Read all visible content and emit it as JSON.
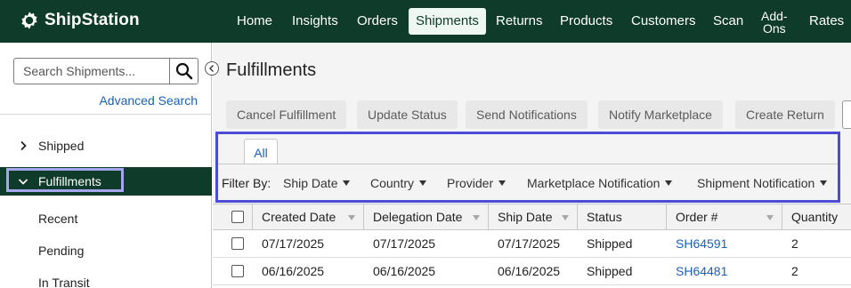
{
  "app": {
    "name": "ShipStation"
  },
  "nav": {
    "items": [
      {
        "label": "Home"
      },
      {
        "label": "Insights"
      },
      {
        "label": "Orders"
      },
      {
        "label": "Shipments"
      },
      {
        "label": "Returns"
      },
      {
        "label": "Products"
      },
      {
        "label": "Customers"
      },
      {
        "label": "Scan"
      },
      {
        "label": "Add-\nOns"
      },
      {
        "label": "Rates"
      }
    ],
    "active": "Shipments"
  },
  "sidebar": {
    "search_placeholder": "Search Shipments...",
    "advanced_search": "Advanced Search",
    "items": [
      {
        "label": "Shipped",
        "expanded": false
      },
      {
        "label": "Fulfillments",
        "expanded": true
      }
    ],
    "subitems": [
      "Recent",
      "Pending",
      "In Transit"
    ]
  },
  "main": {
    "title": "Fulfillments",
    "toolbar": [
      "Cancel Fulfillment",
      "Update Status",
      "Send Notifications",
      "Notify Marketplace",
      "Create Return"
    ],
    "tabs": [
      "All"
    ],
    "filter_label": "Filter By:",
    "filters": [
      "Ship Date",
      "Country",
      "Provider",
      "Marketplace Notification",
      "Shipment Notification"
    ]
  },
  "table": {
    "columns": [
      "Created Date",
      "Delegation Date",
      "Ship Date",
      "Status",
      "Order #",
      "Quantity"
    ],
    "rows": [
      [
        "07/17/2025",
        "07/17/2025",
        "07/17/2025",
        "Shipped",
        "SH64591",
        "2"
      ],
      [
        "06/16/2025",
        "06/16/2025",
        "06/16/2025",
        "Shipped",
        "SH64481",
        "2"
      ]
    ]
  },
  "colors": {
    "brand": "#0e3b2a",
    "link": "#1a61b8",
    "highlight": "#4c4cd6",
    "highlight_light": "#a6a6ee"
  },
  "icons": {
    "logo": "gear-logo-icon",
    "search": "magnifier-icon",
    "collapse": "chevron-left-icon",
    "collapsed": "chevron-right-icon",
    "expanded": "chevron-down-icon",
    "dropdown": "caret-down-icon",
    "sort": "sort-caret-icon"
  }
}
